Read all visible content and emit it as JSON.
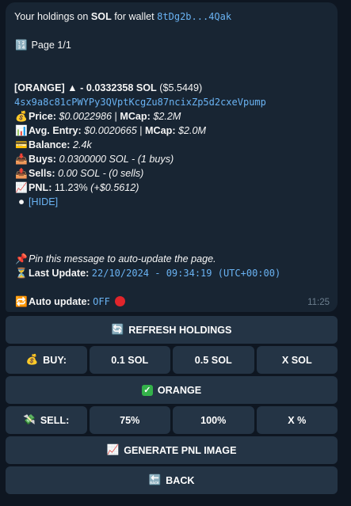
{
  "message": {
    "header_prefix": "Your holdings on ",
    "header_chain": "SOL",
    "header_mid": " for wallet ",
    "wallet_short": "8tDg2b...4Qak",
    "page_icon": "numbers-icon",
    "page_label": "Page 1/1",
    "token_line": {
      "name": "[ORANGE]",
      "arrow": "▲",
      "change": " - 0.0332358 SOL",
      "usd": " ($5.5449)"
    },
    "token_address": "4sx9a8c81cPWYPy3QVptKcgZu87ncixZp5d2cxeVpump",
    "price_label": "Price:",
    "price_value": "$0.0022986",
    "sep1": " | ",
    "mcap_label": "MCap:",
    "mcap_value": "$2.2M",
    "entry_label": "Avg. Entry:",
    "entry_value": "$0.0020665",
    "sep2": " | ",
    "mcap2_label": "MCap:",
    "mcap2_value": "$2.0M",
    "balance_label": "Balance:",
    "balance_value": "2.4k",
    "buys_label": "Buys:",
    "buys_value": "0.0300000 SOL - (1 buys)",
    "sells_label": "Sells:",
    "sells_value": "0.00 SOL - (0 sells)",
    "pnl_label": "PNL:",
    "pnl_value": "11.23%",
    "pnl_usd": "(+$0.5612)",
    "hide_label": "[HIDE]",
    "pin_text": "Pin this message to auto-update the page.",
    "last_update_label": "Last Update:",
    "last_update_value": "22/10/2024 - 09:34:19 (UTC+00:00)",
    "auto_update_label": "Auto update:",
    "auto_update_value": "OFF",
    "time": "11:25"
  },
  "buttons": {
    "refresh": "REFRESH HOLDINGS",
    "buy_label": "BUY:",
    "buy_01": "0.1 SOL",
    "buy_05": "0.5 SOL",
    "buy_x": "X SOL",
    "token": "ORANGE",
    "sell_label": "SELL:",
    "sell_75": "75%",
    "sell_100": "100%",
    "sell_x": "X %",
    "pnl_image": "GENERATE PNL IMAGE",
    "back": "BACK"
  },
  "colors": {
    "background": "#0e1621",
    "bubble": "#182533",
    "button": "#243445",
    "link": "#6ab3f3"
  }
}
